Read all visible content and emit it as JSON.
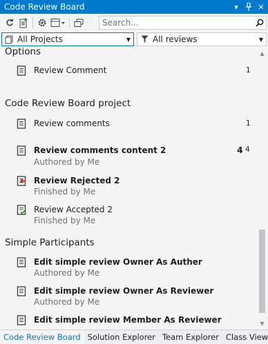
{
  "window": {
    "title": "Code Review Board"
  },
  "toolbar": {
    "search_placeholder": "Search..."
  },
  "filters": {
    "project": "All Projects",
    "reviews": "All reviews"
  },
  "sections": [
    {
      "title": "Options",
      "items": [
        {
          "title": "Review Comment",
          "count": "1",
          "bold": false
        }
      ]
    },
    {
      "title": "Code Review Board project",
      "items": [
        {
          "title": "Review comments",
          "count": "1",
          "bold": false
        },
        {
          "title": "Review comments content 2",
          "subtitle": "Authored by Me",
          "count_main": "4",
          "count_sup": "4",
          "bold": true
        },
        {
          "title": "Review Rejected 2",
          "subtitle": "Finished by Me",
          "bold": true,
          "status": "rejected"
        },
        {
          "title": "Review Accepted 2",
          "subtitle": "Finished by Me",
          "bold": false,
          "status": "accepted"
        }
      ]
    },
    {
      "title": "Simple Participants",
      "items": [
        {
          "title": "Edit simple review Owner As Auther",
          "subtitle": "Authored by Me",
          "bold": true
        },
        {
          "title": "Edit simple review Owner As Reviewer",
          "subtitle": "Authored by Me",
          "bold": true
        },
        {
          "title": "Edit simple review Member As Reviewer",
          "bold": true
        }
      ]
    }
  ],
  "tabs": [
    {
      "label": "Code Review Board",
      "active": true
    },
    {
      "label": "Solution Explorer",
      "active": false
    },
    {
      "label": "Team Explorer",
      "active": false
    },
    {
      "label": "Class View",
      "active": false
    }
  ],
  "colors": {
    "accent": "#007acc",
    "rejected": "#e51400",
    "accepted": "#388a34",
    "subtle_text": "#717171"
  },
  "icons": [
    "refresh-icon",
    "new-review-icon",
    "settings-icon",
    "layout-icon",
    "windows-icon",
    "search-icon",
    "project-icon",
    "filter-icon",
    "document-icon",
    "rejected-document-icon",
    "accepted-document-icon",
    "pin-icon",
    "close-icon",
    "dropdown-icon"
  ]
}
